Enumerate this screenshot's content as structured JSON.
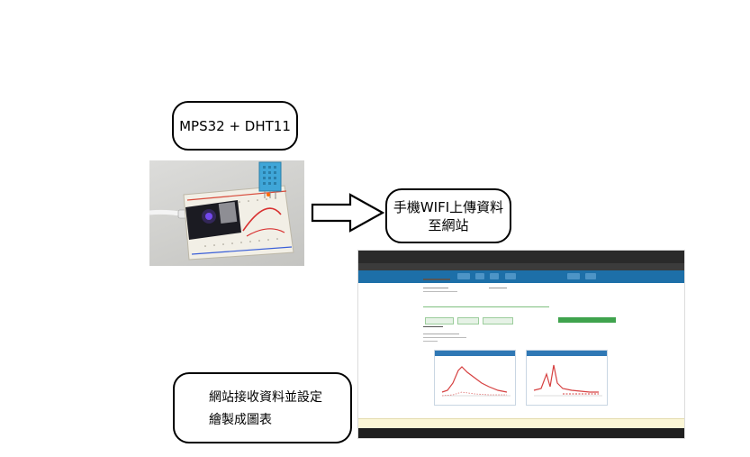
{
  "labels": {
    "hardware": "MPS32 + DHT11",
    "upload_line1": "手機WIFI上傳資料",
    "upload_line2": "至網站",
    "web_line1": "網站接收資料並設定",
    "web_line2": "繪製成圖表"
  },
  "colors": {
    "site_header": "#1d6fa8",
    "chart_line": "#d64040",
    "button_green": "#3fa34d"
  }
}
